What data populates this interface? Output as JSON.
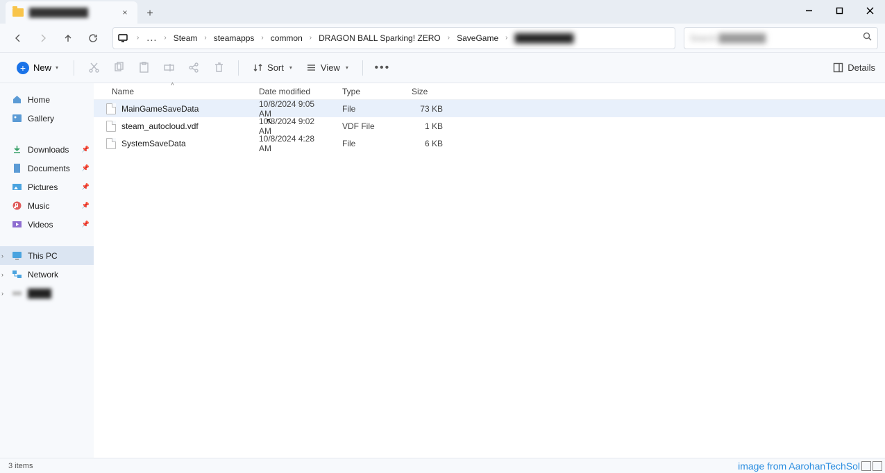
{
  "tab": {
    "title": "██████████",
    "close": "×"
  },
  "breadcrumb": {
    "items": [
      "Steam",
      "steamapps",
      "common",
      "DRAGON BALL Sparking! ZERO",
      "SaveGame",
      "██████████"
    ]
  },
  "search": {
    "placeholder": "Search ████████"
  },
  "toolbar": {
    "new": "New",
    "sort": "Sort",
    "view": "View",
    "details": "Details"
  },
  "sidebar": {
    "home": "Home",
    "gallery": "Gallery",
    "downloads": "Downloads",
    "documents": "Documents",
    "pictures": "Pictures",
    "music": "Music",
    "videos": "Videos",
    "thispc": "This PC",
    "network": "Network",
    "extra": "████"
  },
  "columns": {
    "name": "Name",
    "date": "Date modified",
    "type": "Type",
    "size": "Size"
  },
  "files": [
    {
      "name": "MainGameSaveData",
      "date": "10/8/2024 9:05 AM",
      "type": "File",
      "size": "73 KB"
    },
    {
      "name": "steam_autocloud.vdf",
      "date": "10/8/2024 9:02 AM",
      "type": "VDF File",
      "size": "1 KB"
    },
    {
      "name": "SystemSaveData",
      "date": "10/8/2024 4:28 AM",
      "type": "File",
      "size": "6 KB"
    }
  ],
  "status": {
    "count": "3 items"
  },
  "watermark": "image from AarohanTechSol"
}
